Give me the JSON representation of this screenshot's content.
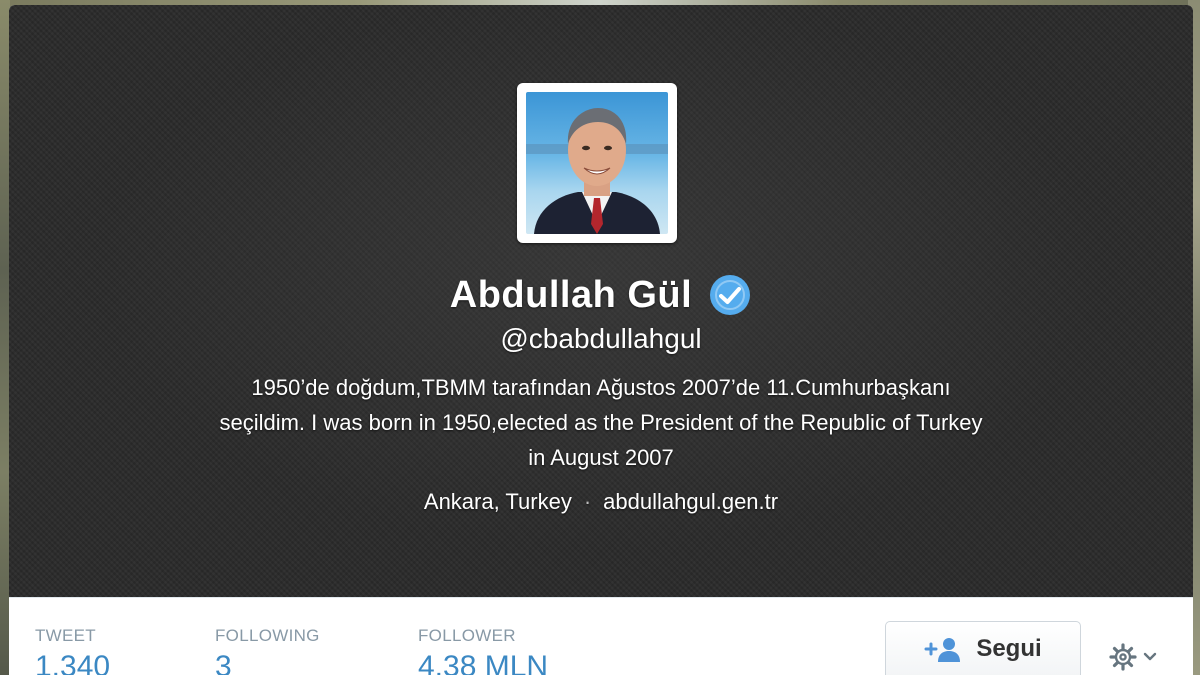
{
  "profile": {
    "name": "Abdullah Gül",
    "handle": "@cbabdullahgul",
    "bio": [
      "1950’de doğdum,TBMM tarafından Ağustos 2007’de 11.Cumhurbaşkanı",
      "seçildim.  I was born in 1950,elected as the President of the Republic of Turkey",
      "in August 2007"
    ],
    "location": "Ankara, Turkey",
    "separator": "·",
    "website": "abdullahgul.gen.tr",
    "verified": true
  },
  "stats": [
    {
      "label": "TWEET",
      "value": "1.340"
    },
    {
      "label": "FOLLOWING",
      "value": "3"
    },
    {
      "label": "FOLLOWER",
      "value": "4,38 MLN"
    }
  ],
  "actions": {
    "follow_label": "Segui",
    "follow_icon": "add-user-icon",
    "settings_icon": "gear-icon"
  },
  "colors": {
    "verified_badge": "#55acee",
    "stat_value": "#3b88c3",
    "stat_label": "#8899a6"
  }
}
